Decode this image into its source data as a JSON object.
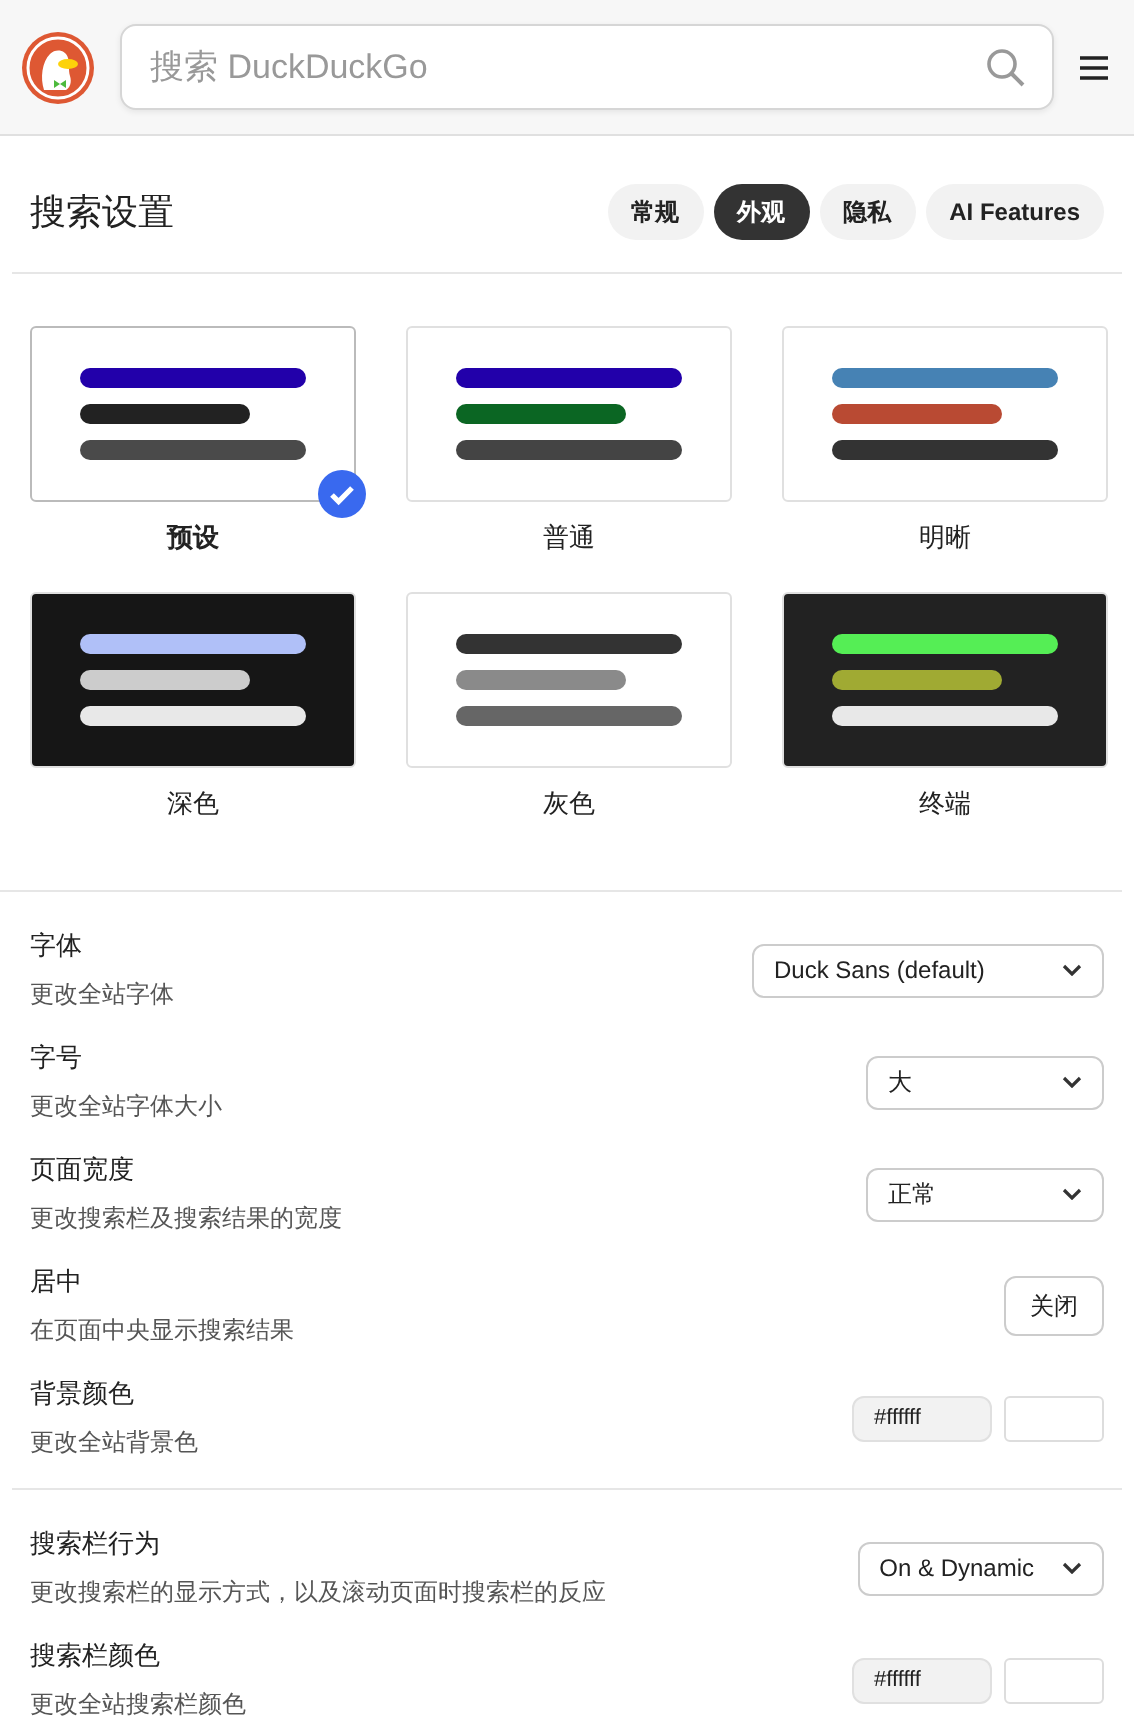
{
  "header": {
    "search": {
      "placeholder": "搜索 DuckDuckGo"
    }
  },
  "title": "搜索设置",
  "tabs": [
    {
      "label": "常规",
      "selected": false
    },
    {
      "label": "外观",
      "selected": true
    },
    {
      "label": "隐私",
      "selected": false
    },
    {
      "label": "AI Features",
      "selected": false
    }
  ],
  "themes": [
    {
      "label": "预设",
      "selected": true,
      "color": "#ffffff",
      "bars": [
        {
          "color": "#2200aa"
        },
        {
          "color": "#222222"
        },
        {
          "color": "#4a4a4a"
        }
      ]
    },
    {
      "label": "普通",
      "selected": false,
      "color": "#ffffff",
      "bars": [
        {
          "color": "#2200aa"
        },
        {
          "color": "#0b6623"
        },
        {
          "color": "#444444"
        }
      ]
    },
    {
      "label": "明晰",
      "selected": false,
      "color": "#ffffff",
      "bars": [
        {
          "color": "#4682b4"
        },
        {
          "color": "#b94a33"
        },
        {
          "color": "#333333"
        }
      ]
    },
    {
      "label": "深色",
      "selected": false,
      "color": "#161616",
      "bars": [
        {
          "color": "#b0c0f8"
        },
        {
          "color": "#cccccc"
        },
        {
          "color": "#e8e8e8"
        }
      ]
    },
    {
      "label": "灰色",
      "selected": false,
      "color": "#ffffff",
      "bars": [
        {
          "color": "#333333"
        },
        {
          "color": "#8a8a8a"
        },
        {
          "color": "#666666"
        }
      ]
    },
    {
      "label": "终端",
      "selected": false,
      "color": "#222222",
      "bars": [
        {
          "color": "#55ee55"
        },
        {
          "color": "#a0aa33"
        },
        {
          "color": "#e8e8e8"
        }
      ]
    }
  ],
  "settings_groups": [
    [
      {
        "kind": "select",
        "label": "字体",
        "description": "更改全站字体",
        "value": "Duck Sans (default)"
      },
      {
        "kind": "select",
        "label": "字号",
        "description": "更改全站字体大小",
        "value": "大"
      },
      {
        "kind": "select",
        "label": "页面宽度",
        "description": "更改搜索栏及搜索结果的宽度",
        "value": "正常"
      },
      {
        "kind": "toggle",
        "label": "居中",
        "description": "在页面中央显示搜索结果",
        "value": "关闭"
      },
      {
        "kind": "color",
        "label": "背景颜色",
        "description": "更改全站背景色",
        "value": "#ffffff",
        "color": "#ffffff"
      }
    ],
    [
      {
        "kind": "select",
        "label": "搜索栏行为",
        "description": "更改搜索栏的显示方式，以及滚动页面时搜索栏的反应",
        "value": "On & Dynamic"
      },
      {
        "kind": "color",
        "label": "搜索栏颜色",
        "description": "更改全站搜索栏颜色",
        "value": "#ffffff",
        "color": "#ffffff"
      }
    ]
  ]
}
